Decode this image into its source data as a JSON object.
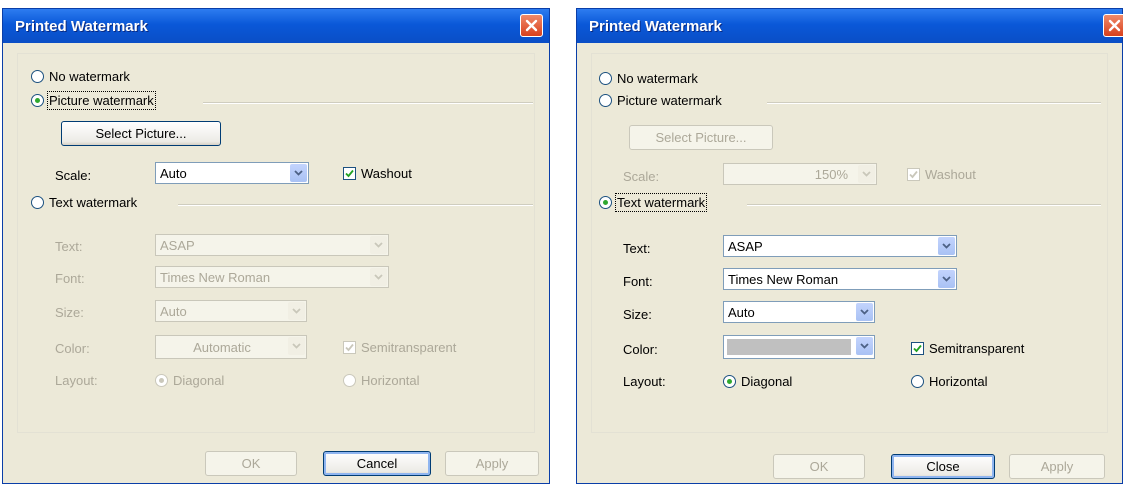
{
  "left": {
    "title": "Printed Watermark",
    "no_watermark": "No watermark",
    "picture_watermark": "Picture watermark",
    "select_picture": "Select Picture...",
    "scale_label": "Scale:",
    "scale_value": "Auto",
    "washout": "Washout",
    "text_watermark": "Text watermark",
    "text_label": "Text:",
    "text_value": "ASAP",
    "font_label": "Font:",
    "font_value": "Times New Roman",
    "size_label": "Size:",
    "size_value": "Auto",
    "color_label": "Color:",
    "color_value": "Automatic",
    "semitransparent": "Semitransparent",
    "layout_label": "Layout:",
    "diagonal": "Diagonal",
    "horizontal": "Horizontal",
    "ok": "OK",
    "cancel": "Cancel",
    "apply": "Apply"
  },
  "right": {
    "title": "Printed Watermark",
    "no_watermark": "No watermark",
    "picture_watermark": "Picture watermark",
    "select_picture": "Select Picture...",
    "scale_label": "Scale:",
    "scale_value": "150%",
    "washout": "Washout",
    "text_watermark": "Text watermark",
    "text_label": "Text:",
    "text_value": "ASAP",
    "font_label": "Font:",
    "font_value": "Times New Roman",
    "size_label": "Size:",
    "size_value": "Auto",
    "color_label": "Color:",
    "color_value": "",
    "semitransparent": "Semitransparent",
    "layout_label": "Layout:",
    "diagonal": "Diagonal",
    "horizontal": "Horizontal",
    "ok": "OK",
    "close": "Close",
    "apply": "Apply"
  },
  "colors": {
    "titlebar": "#0a58d8",
    "dialog_bg": "#ece9d8",
    "radio_dot": "#2fa82f",
    "disabled_text": "#aca899",
    "color_swatch": "#c0c0c0"
  },
  "icons": [
    "close-icon",
    "chevron-down-icon",
    "checkmark-icon"
  ]
}
